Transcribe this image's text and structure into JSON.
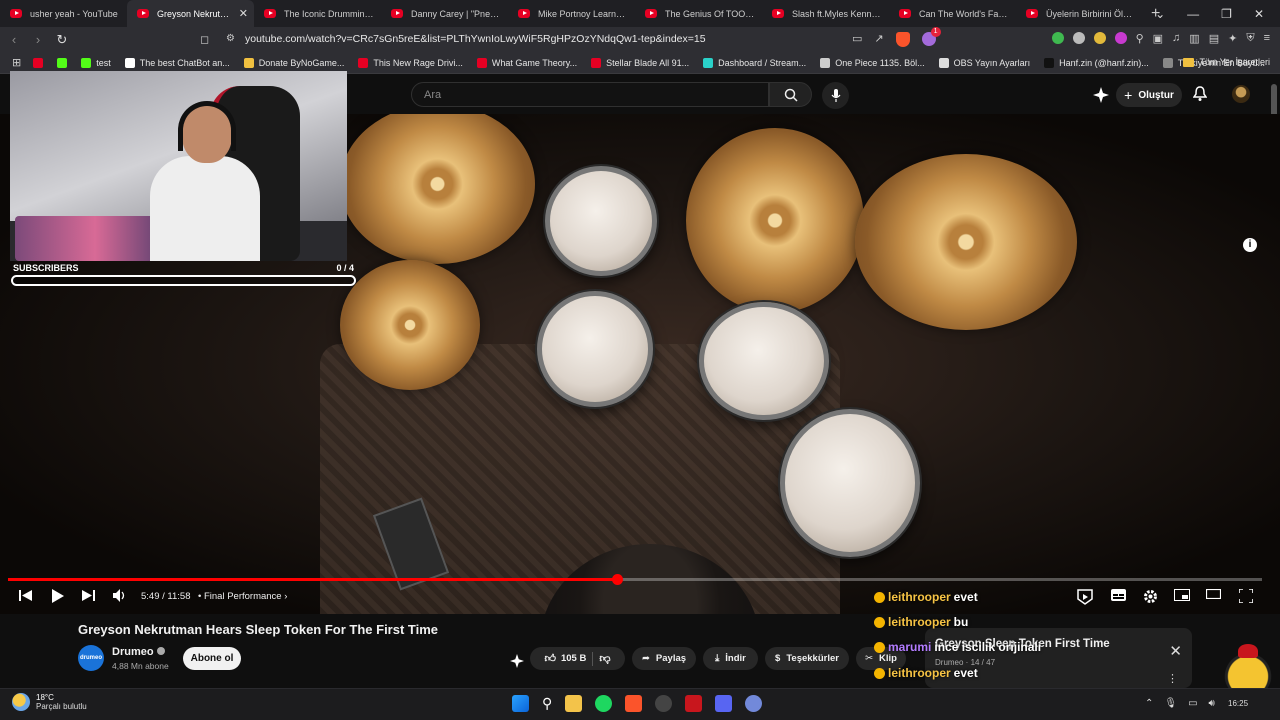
{
  "browser": {
    "tabs": [
      {
        "label": "usher yeah - YouTube",
        "active": false
      },
      {
        "label": "Greyson Nekrutman H",
        "active": true
      },
      {
        "label": "The Iconic Drumming Beh",
        "active": false
      },
      {
        "label": "Danny Carey | \"Pneuma\" b",
        "active": false
      },
      {
        "label": "Mike Portnoy Learns Impo",
        "active": false
      },
      {
        "label": "The Genius Of TOOL's \"Pn",
        "active": false
      },
      {
        "label": "Slash ft.Myles Kennedy &",
        "active": false
      },
      {
        "label": "Can The World's Fastest D",
        "active": false
      },
      {
        "label": "Üyelerin Birbirini Öldürdü",
        "active": false
      }
    ],
    "url": "youtube.com/watch?v=CRc7sGn5reE&list=PLThYwnIoLwyWiF5RgHPzOzYNdqQw1-tep&index=15",
    "bookmarks": [
      {
        "label": "",
        "color": "#e60023"
      },
      {
        "label": "",
        "color": "#53fc18"
      },
      {
        "label": "test",
        "color": "#53fc18"
      },
      {
        "label": "The best ChatBot an...",
        "color": "#ffffff"
      },
      {
        "label": "Donate ByNoGame...",
        "color": "#f0c040"
      },
      {
        "label": "This New Rage Drivi...",
        "color": "#e60023"
      },
      {
        "label": "What Game Theory...",
        "color": "#e60023"
      },
      {
        "label": "Stellar Blade All 91...",
        "color": "#e60023"
      },
      {
        "label": "Dashboard / Stream...",
        "color": "#2ad1c9"
      },
      {
        "label": "One Piece 1135. Böl...",
        "color": "#cccccc"
      },
      {
        "label": "OBS Yayın Ayarları",
        "color": "#dddddd"
      },
      {
        "label": "Hanf.zin (@hanf.zin)...",
        "color": "#111111"
      },
      {
        "label": "Türkiye'nin En Büyü...",
        "color": "#888888"
      }
    ],
    "bookmarks_all": "Tüm Yer İşaretleri"
  },
  "youtube": {
    "search_placeholder": "Ara",
    "create_label": "Oluştur",
    "video": {
      "title": "Greyson Nekrutman Hears Sleep Token For The First Time",
      "time": "5:49 / 11:58",
      "chapter": "Final Performance",
      "progress": 0.486,
      "channel": "Drumeo",
      "channel_avatar_text": "drumeo",
      "subscribers": "4,88 Mn abone",
      "subscribe_label": "Abone ol",
      "likes": "105 B",
      "share_label": "Paylaş",
      "download_label": "İndir",
      "thanks_label": "Teşekkürler",
      "clip_label": "Klip"
    },
    "miniplayer": {
      "title": "Greyson Sleep Token First Time",
      "subtitle": "Drumeo · 14 / 47"
    }
  },
  "overlay": {
    "subscribers_label": "SUBSCRIBERS",
    "subscribers_count": "0 / 4",
    "subscribers_progress": 0,
    "chat": [
      {
        "user": "leithrooper",
        "message": "evet"
      },
      {
        "user": "leithrooper",
        "message": "bu"
      },
      {
        "user": "marumi",
        "message": "ince iscilik orijinali"
      },
      {
        "user": "leithrooper",
        "message": "evet"
      }
    ]
  },
  "taskbar": {
    "temperature": "18°C",
    "weather": "Parçalı bulutlu",
    "time": "16:25"
  }
}
